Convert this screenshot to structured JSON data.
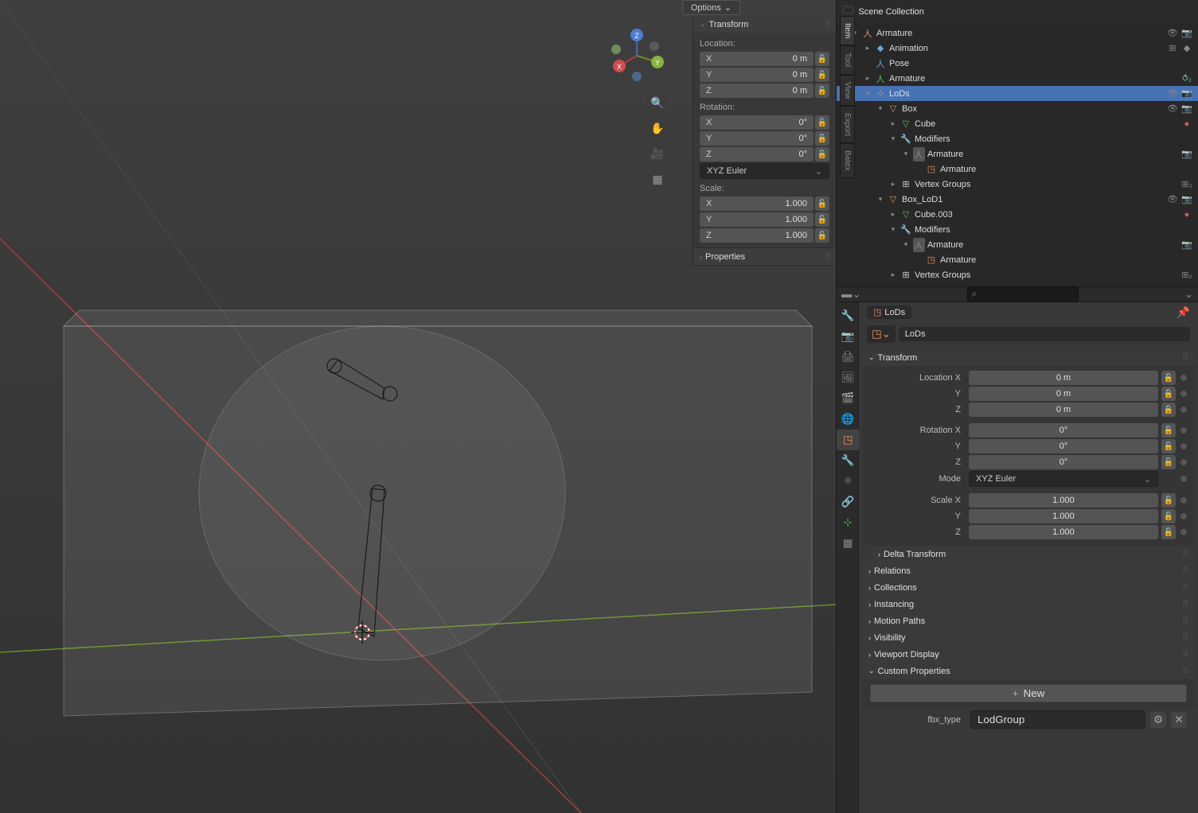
{
  "viewportHeader": {
    "options": "Options"
  },
  "gizmo": {
    "x": "X",
    "y": "Y",
    "z": "Z"
  },
  "npanel": {
    "tabs": [
      "Item",
      "Tool",
      "View",
      "Export",
      "Batex"
    ],
    "transform": {
      "title": "Transform",
      "location": {
        "label": "Location:",
        "x": "X",
        "y": "Y",
        "z": "Z",
        "xv": "0 m",
        "yv": "0 m",
        "zv": "0 m"
      },
      "rotation": {
        "label": "Rotation:",
        "x": "X",
        "y": "Y",
        "z": "Z",
        "xv": "0°",
        "yv": "0°",
        "zv": "0°",
        "mode": "XYZ Euler"
      },
      "scale": {
        "label": "Scale:",
        "x": "X",
        "y": "Y",
        "z": "Z",
        "xv": "1.000",
        "yv": "1.000",
        "zv": "1.000"
      }
    },
    "properties": {
      "title": "Properties"
    }
  },
  "outliner": {
    "header": "Scene Collection",
    "rows": [
      {
        "depth": 1,
        "exp": "▾",
        "icon": "arm",
        "label": "Armature",
        "vis": true,
        "cam": true
      },
      {
        "depth": 2,
        "exp": "▸",
        "icon": "anim",
        "label": "Animation",
        "extra1": true,
        "extra2": true
      },
      {
        "depth": 2,
        "exp": "",
        "icon": "pose",
        "label": "Pose"
      },
      {
        "depth": 2,
        "exp": "▸",
        "icon": "arm2",
        "label": "Armature",
        "extraBone": true
      },
      {
        "depth": 2,
        "exp": "▾",
        "icon": "empty",
        "label": "LoDs",
        "selected": true,
        "vis": true,
        "cam": true
      },
      {
        "depth": 3,
        "exp": "▾",
        "icon": "mesh",
        "label": "Box",
        "vis": true,
        "cam": true
      },
      {
        "depth": 4,
        "exp": "▸",
        "icon": "meshdata",
        "label": "Cube",
        "mat": true
      },
      {
        "depth": 4,
        "exp": "▾",
        "icon": "mod",
        "label": "Modifiers"
      },
      {
        "depth": 5,
        "exp": "▾",
        "icon": "armmod",
        "label": "Armature",
        "cam": true
      },
      {
        "depth": 6,
        "exp": "",
        "icon": "obj",
        "label": "Armature"
      },
      {
        "depth": 4,
        "exp": "▸",
        "icon": "vgroup",
        "label": "Vertex Groups",
        "extraVg": true
      },
      {
        "depth": 3,
        "exp": "▾",
        "icon": "mesh",
        "label": "Box_LoD1",
        "vis": true,
        "cam": true
      },
      {
        "depth": 4,
        "exp": "▸",
        "icon": "meshdata",
        "label": "Cube.003",
        "mat": true
      },
      {
        "depth": 4,
        "exp": "▾",
        "icon": "mod",
        "label": "Modifiers"
      },
      {
        "depth": 5,
        "exp": "▾",
        "icon": "armmod",
        "label": "Armature",
        "cam": true
      },
      {
        "depth": 6,
        "exp": "",
        "icon": "obj",
        "label": "Armature"
      },
      {
        "depth": 4,
        "exp": "▸",
        "icon": "vgroup",
        "label": "Vertex Groups",
        "extraVg": true
      }
    ]
  },
  "props": {
    "breadcrumb": {
      "label": "LoDs"
    },
    "datablock": {
      "name": "LoDs"
    },
    "transform": {
      "title": "Transform",
      "locX": {
        "label": "Location X",
        "v": "0 m"
      },
      "locY": {
        "label": "Y",
        "v": "0 m"
      },
      "locZ": {
        "label": "Z",
        "v": "0 m"
      },
      "rotX": {
        "label": "Rotation X",
        "v": "0°"
      },
      "rotY": {
        "label": "Y",
        "v": "0°"
      },
      "rotZ": {
        "label": "Z",
        "v": "0°"
      },
      "mode": {
        "label": "Mode",
        "v": "XYZ Euler"
      },
      "scaX": {
        "label": "Scale X",
        "v": "1.000"
      },
      "scaY": {
        "label": "Y",
        "v": "1.000"
      },
      "scaZ": {
        "label": "Z",
        "v": "1.000"
      }
    },
    "sections": {
      "delta": "Delta Transform",
      "relations": "Relations",
      "collections": "Collections",
      "instancing": "Instancing",
      "motion": "Motion Paths",
      "visibility": "Visibility",
      "viewport": "Viewport Display",
      "custom": "Custom Properties"
    },
    "custom": {
      "new": "New",
      "prop": {
        "key": "fbx_type",
        "value": "LodGroup"
      }
    }
  }
}
